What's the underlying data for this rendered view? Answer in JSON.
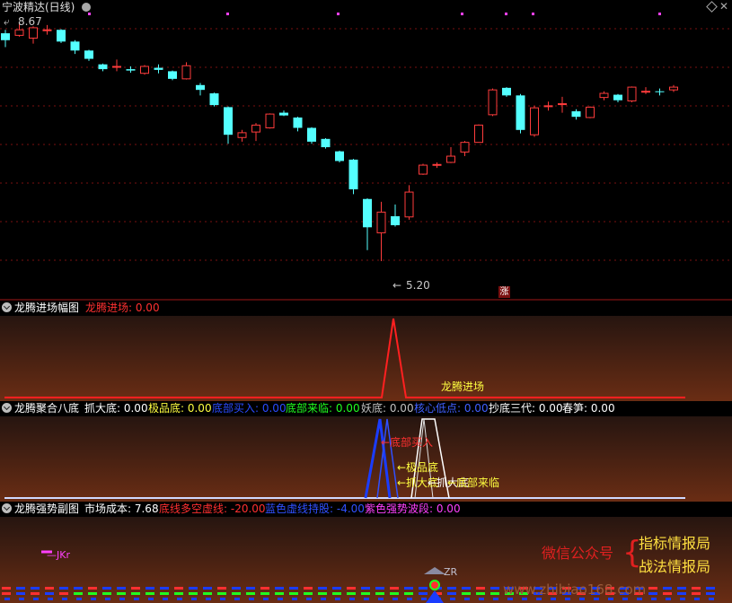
{
  "main_chart": {
    "title": "宁波精达(日线)",
    "high_marker": "8.67",
    "low_marker": "5.20",
    "zhang_badge": "涨"
  },
  "panel1": {
    "title": "龙腾进场幅图",
    "value_label": "龙腾进场: 0.00",
    "chart_label": "龙腾进场"
  },
  "panel2": {
    "title": "龙腾聚合八底",
    "items": [
      {
        "label": "抓大底: 0.00",
        "color": "#ffffff"
      },
      {
        "label": "极品底: 0.00",
        "color": "#ffff40"
      },
      {
        "label": "底部买入: 0.00",
        "color": "#2a4bff"
      },
      {
        "label": "底部来临: 0.00",
        "color": "#20ff20"
      },
      {
        "label": "妖底: 0.00",
        "color": "#c0c0c0"
      },
      {
        "label": "核心低点: 0.00",
        "color": "#4060ff"
      },
      {
        "label": "抄底三代: 0.00",
        "color": "#ffffff"
      },
      {
        "label": "春笋: 0.00",
        "color": "#ffffff"
      }
    ],
    "chart_labels": [
      "←底部买入",
      "←极品底",
      "←抓大底",
      "←抓大底",
      "←底部来临"
    ]
  },
  "panel3": {
    "title": "龙腾强势副图",
    "items": [
      {
        "label": "市场成本: 7.68",
        "color": "#ffffff"
      },
      {
        "label": "底线多空虚线: -20.00",
        "color": "#ff3030"
      },
      {
        "label": "蓝色虚线持股: -4.00",
        "color": "#3050ff"
      },
      {
        "label": "紫色强势波段: 0.00",
        "color": "#ff40ff"
      }
    ],
    "chart_label": "—JKr",
    "zr_label": "ZR"
  },
  "watermark": {
    "left_text": "微信公众号",
    "line1": "指标情报局",
    "line2": "战法情报局",
    "url": "www.zhibiao168.com"
  },
  "candles": [
    {
      "o": 8.4,
      "c": 8.5,
      "h": 8.55,
      "l": 8.3,
      "up": false
    },
    {
      "o": 8.47,
      "c": 8.55,
      "h": 8.67,
      "l": 8.45,
      "up": true
    },
    {
      "o": 8.43,
      "c": 8.58,
      "h": 8.6,
      "l": 8.35,
      "up": true
    },
    {
      "o": 8.55,
      "c": 8.55,
      "h": 8.62,
      "l": 8.48,
      "up": true
    },
    {
      "o": 8.55,
      "c": 8.38,
      "h": 8.56,
      "l": 8.36,
      "up": false
    },
    {
      "o": 8.38,
      "c": 8.25,
      "h": 8.4,
      "l": 8.2,
      "up": false
    },
    {
      "o": 8.25,
      "c": 8.13,
      "h": 8.26,
      "l": 8.1,
      "up": false
    },
    {
      "o": 8.05,
      "c": 7.98,
      "h": 8.06,
      "l": 7.95,
      "up": false
    },
    {
      "o": 8.02,
      "c": 8.02,
      "h": 8.12,
      "l": 7.95,
      "up": true
    },
    {
      "o": 7.98,
      "c": 7.96,
      "h": 8.02,
      "l": 7.93,
      "up": false
    },
    {
      "o": 7.92,
      "c": 8.02,
      "h": 8.04,
      "l": 7.9,
      "up": true
    },
    {
      "o": 8.0,
      "c": 7.97,
      "h": 8.05,
      "l": 7.92,
      "up": false
    },
    {
      "o": 7.95,
      "c": 7.84,
      "h": 7.96,
      "l": 7.82,
      "up": false
    },
    {
      "o": 7.84,
      "c": 8.03,
      "h": 8.08,
      "l": 7.83,
      "up": true
    },
    {
      "o": 7.75,
      "c": 7.68,
      "h": 7.78,
      "l": 7.6,
      "up": false
    },
    {
      "o": 7.63,
      "c": 7.46,
      "h": 7.64,
      "l": 7.44,
      "up": false
    },
    {
      "o": 7.43,
      "c": 7.03,
      "h": 7.44,
      "l": 6.9,
      "up": false
    },
    {
      "o": 6.99,
      "c": 7.06,
      "h": 7.1,
      "l": 6.93,
      "up": true
    },
    {
      "o": 7.07,
      "c": 7.17,
      "h": 7.2,
      "l": 6.94,
      "up": true
    },
    {
      "o": 7.13,
      "c": 7.33,
      "h": 7.34,
      "l": 7.12,
      "up": true
    },
    {
      "o": 7.35,
      "c": 7.31,
      "h": 7.38,
      "l": 7.3,
      "up": false
    },
    {
      "o": 7.28,
      "c": 7.13,
      "h": 7.29,
      "l": 7.08,
      "up": false
    },
    {
      "o": 7.13,
      "c": 6.93,
      "h": 7.14,
      "l": 6.9,
      "up": false
    },
    {
      "o": 6.97,
      "c": 6.85,
      "h": 6.98,
      "l": 6.83,
      "up": false
    },
    {
      "o": 6.79,
      "c": 6.65,
      "h": 6.8,
      "l": 6.63,
      "up": false
    },
    {
      "o": 6.67,
      "c": 6.24,
      "h": 6.68,
      "l": 6.17,
      "up": false
    },
    {
      "o": 6.1,
      "c": 5.69,
      "h": 6.11,
      "l": 5.36,
      "up": false
    },
    {
      "o": 5.61,
      "c": 5.91,
      "h": 6.06,
      "l": 5.2,
      "up": true
    },
    {
      "o": 5.85,
      "c": 5.72,
      "h": 6.02,
      "l": 5.7,
      "up": false
    },
    {
      "o": 5.84,
      "c": 6.2,
      "h": 6.3,
      "l": 5.8,
      "up": true
    },
    {
      "o": 6.46,
      "c": 6.59,
      "h": 6.61,
      "l": 6.45,
      "up": true
    },
    {
      "o": 6.59,
      "c": 6.6,
      "h": 6.63,
      "l": 6.55,
      "up": true
    },
    {
      "o": 6.63,
      "c": 6.72,
      "h": 6.85,
      "l": 6.62,
      "up": true
    },
    {
      "o": 6.78,
      "c": 6.92,
      "h": 6.94,
      "l": 6.72,
      "up": true
    },
    {
      "o": 6.92,
      "c": 7.17,
      "h": 7.18,
      "l": 6.92,
      "up": true
    },
    {
      "o": 7.32,
      "c": 7.68,
      "h": 7.7,
      "l": 7.3,
      "up": true
    },
    {
      "o": 7.71,
      "c": 7.6,
      "h": 7.72,
      "l": 7.58,
      "up": false
    },
    {
      "o": 7.6,
      "c": 7.1,
      "h": 7.62,
      "l": 7.05,
      "up": false
    },
    {
      "o": 7.03,
      "c": 7.42,
      "h": 7.45,
      "l": 7.0,
      "up": true
    },
    {
      "o": 7.45,
      "c": 7.45,
      "h": 7.51,
      "l": 7.38,
      "up": true
    },
    {
      "o": 7.48,
      "c": 7.48,
      "h": 7.58,
      "l": 7.35,
      "up": true
    },
    {
      "o": 7.37,
      "c": 7.29,
      "h": 7.4,
      "l": 7.25,
      "up": false
    },
    {
      "o": 7.28,
      "c": 7.43,
      "h": 7.44,
      "l": 7.27,
      "up": true
    },
    {
      "o": 7.57,
      "c": 7.63,
      "h": 7.66,
      "l": 7.53,
      "up": true
    },
    {
      "o": 7.61,
      "c": 7.53,
      "h": 7.62,
      "l": 7.5,
      "up": false
    },
    {
      "o": 7.52,
      "c": 7.72,
      "h": 7.73,
      "l": 7.5,
      "up": true
    },
    {
      "o": 7.66,
      "c": 7.66,
      "h": 7.72,
      "l": 7.62,
      "up": true
    },
    {
      "o": 7.66,
      "c": 7.66,
      "h": 7.7,
      "l": 7.6,
      "up": false
    },
    {
      "o": 7.68,
      "c": 7.72,
      "h": 7.75,
      "l": 7.65,
      "up": true
    }
  ]
}
